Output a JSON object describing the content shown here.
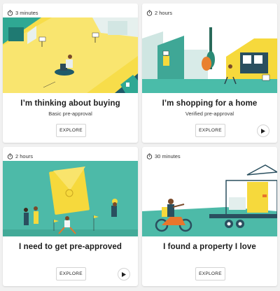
{
  "cards": [
    {
      "duration": "3 minutes",
      "title": "I’m thinking about buying",
      "subtitle": "Basic pre-approval",
      "button_label": "EXPLORE",
      "has_play": false
    },
    {
      "duration": "2 hours",
      "title": "I’m shopping for a home",
      "subtitle": "Verified pre-approval",
      "button_label": "EXPLORE",
      "has_play": true
    },
    {
      "duration": "2 hours",
      "title": "I need to get pre-approved",
      "subtitle": "",
      "button_label": "EXPLORE",
      "has_play": true
    },
    {
      "duration": "30 minutes",
      "title": "I found a property I love",
      "subtitle": "",
      "button_label": "EXPLORE",
      "has_play": false
    }
  ],
  "icons": {
    "duration": "stopwatch-icon",
    "play": "play-icon"
  },
  "colors": {
    "teal": "#3fb5a3",
    "yellow": "#f6d93c",
    "orange": "#e8762c",
    "navy": "#1f3f52"
  }
}
